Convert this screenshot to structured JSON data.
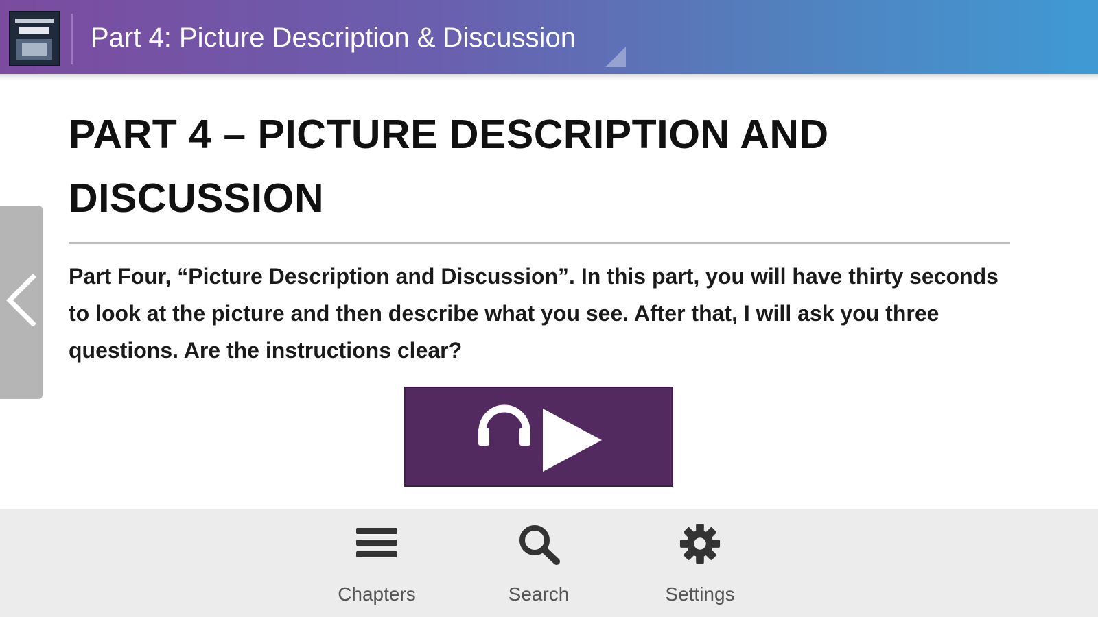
{
  "header": {
    "title": "Part 4: Picture Description & Discussion",
    "gradient_start": "#7b4b9f",
    "gradient_end": "#3f9ad4"
  },
  "main": {
    "heading": "PART 4 – PICTURE DESCRIPTION AND DISCUSSION",
    "paragraph": "Part Four, “Picture Description and Discussion”. In this part, you will have thirty seconds to look at the picture and then describe what you see. After that, I will ask you three questions. Are the instructions clear?",
    "audio_button": {
      "icons": [
        "headphones-icon",
        "play-icon"
      ],
      "color": "#522a60"
    }
  },
  "side": {
    "back_icon": "chevron-left-icon"
  },
  "bottom_nav": {
    "items": [
      {
        "label": "Chapters",
        "icon": "menu-icon"
      },
      {
        "label": "Search",
        "icon": "search-icon"
      },
      {
        "label": "Settings",
        "icon": "gear-icon"
      }
    ]
  }
}
